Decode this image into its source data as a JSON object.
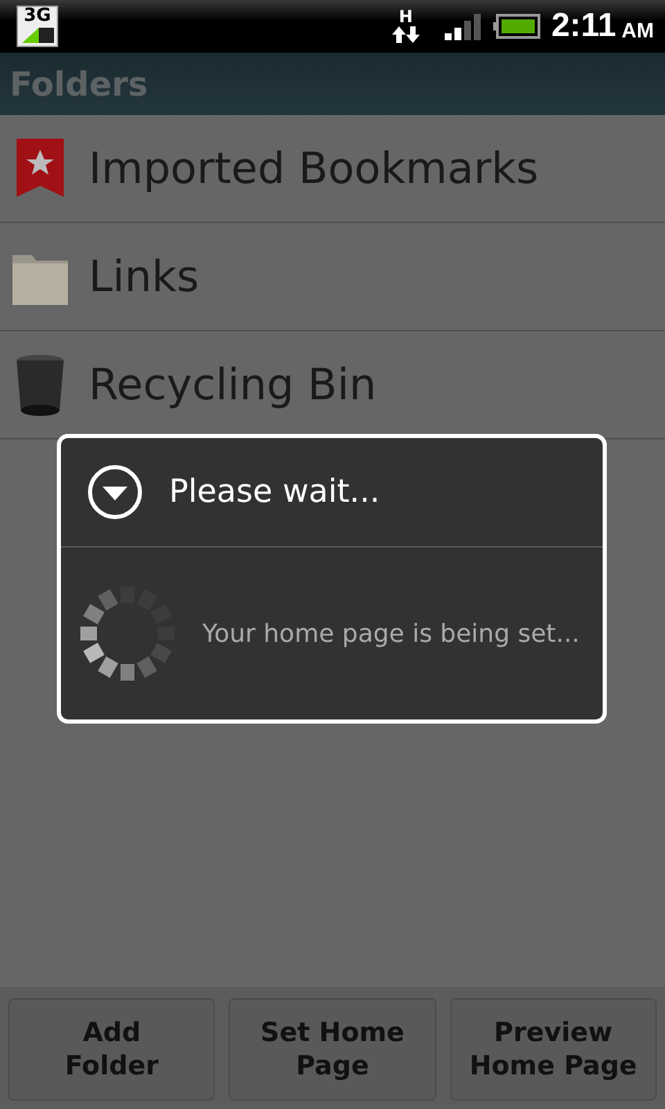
{
  "status_bar": {
    "network": "3G",
    "data_type": "H",
    "time": "2:11",
    "ampm": "AM"
  },
  "title": "Folders",
  "folders": [
    {
      "name": "Imported Bookmarks",
      "kind": "bookmarks"
    },
    {
      "name": "Links",
      "kind": "folder"
    },
    {
      "name": "Recycling Bin",
      "kind": "trash"
    }
  ],
  "dialog": {
    "title": "Please wait...",
    "message": "Your home page is being set..."
  },
  "buttons": [
    {
      "lines": [
        "Add",
        "Folder"
      ]
    },
    {
      "lines": [
        "Set Home",
        "Page"
      ]
    },
    {
      "lines": [
        "Preview",
        "Home Page"
      ]
    }
  ]
}
